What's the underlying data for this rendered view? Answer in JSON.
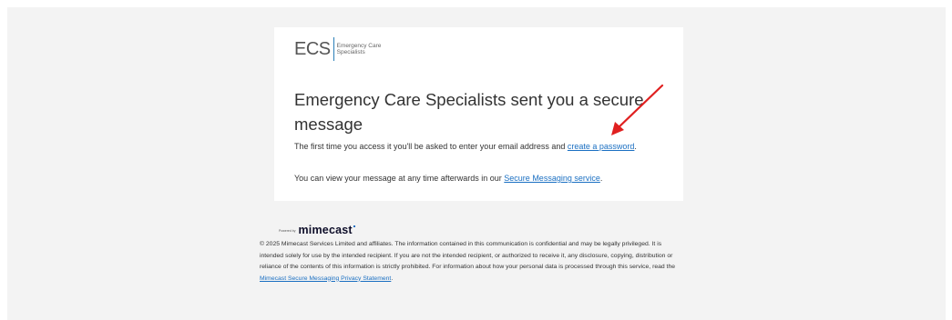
{
  "logo": {
    "mark": "ECS",
    "line1": "Emergency Care",
    "line2": "Specialists"
  },
  "message": {
    "headline": "Emergency Care Specialists sent you a secure message",
    "para1_text": "The first time you access it you'll be asked to enter your email address and ",
    "para1_link": "create a password",
    "para1_end": ".",
    "para2_text": "You can view your message at any time afterwards in our ",
    "para2_link": "Secure Messaging service",
    "para2_end": "."
  },
  "footer": {
    "powered_by": "Powered by",
    "brand": "mimecast",
    "legal_text": "© 2025 Mimecast Services Limited and affiliates. The information contained in this communication is confidential and may be legally privileged. It is intended solely for use by the intended recipient. If you are not the intended recipient, or authorized to receive it, any disclosure, copying, distribution or reliance of the contents of this information is strictly prohibited. For information about how your personal data is processed through this service, read the ",
    "legal_link": "Mimecast Secure Messaging Privacy Statement",
    "legal_end": "."
  },
  "colors": {
    "page_bg": "#f3f3f3",
    "card_bg": "#ffffff",
    "link": "#1a6fc2",
    "arrow": "#e02020"
  }
}
